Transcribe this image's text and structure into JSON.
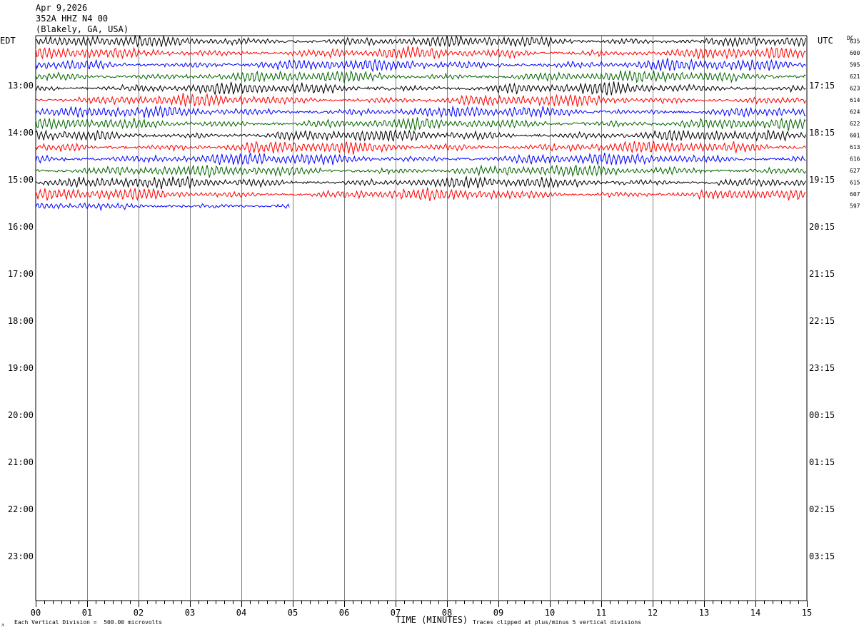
{
  "header": {
    "date": "Apr 9,2026",
    "station": "352A HHZ N4 00",
    "location": "(Blakely, GA, USA)"
  },
  "left_zone": "EDT",
  "right_zone": "UTC",
  "dc_label": "DC",
  "footer": {
    "scale_note": "Each Vertical Division =  500.00 microvolts",
    "clip_note": "Traces clipped at plus/minus 5 vertical divisions",
    "corner_mark": "ᴧ"
  },
  "colors": [
    "#000000",
    "#ff0000",
    "#0000ff",
    "#006400"
  ],
  "chart_data": {
    "type": "line",
    "title": "Apr 9,2026 352A HHZ N4 00 (Blakely, GA, USA)",
    "xlabel": "TIME (MINUTES)",
    "xlim": [
      0,
      15
    ],
    "x_ticks": [
      "00",
      "01",
      "02",
      "03",
      "04",
      "05",
      "06",
      "07",
      "08",
      "09",
      "10",
      "11",
      "12",
      "13",
      "14",
      "15"
    ],
    "left_hour_labels": [
      "13:00",
      "14:00",
      "15:00",
      "16:00",
      "17:00",
      "18:00",
      "19:00",
      "20:00",
      "21:00",
      "22:00",
      "23:00"
    ],
    "right_hour_labels": [
      "17:15",
      "18:15",
      "19:15",
      "20:15",
      "21:15",
      "22:15",
      "23:15",
      "00:15",
      "01:15",
      "02:15",
      "03:15"
    ],
    "dc_values": [
      "635",
      "600",
      "595",
      "621",
      "623",
      "614",
      "624",
      "622",
      "601",
      "613",
      "616",
      "627",
      "615",
      "607",
      "597"
    ],
    "traces_total": 15,
    "last_trace_end_minute": 4.95,
    "grid": "vertical lines each minute"
  }
}
